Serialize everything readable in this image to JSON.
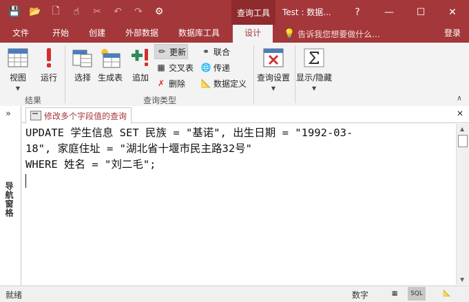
{
  "titlebar": {
    "context_title": "查询工具",
    "window_title": "Test : 数据...",
    "help": "?",
    "minimize": "—",
    "maximize": "☐",
    "close": "✕"
  },
  "qat": {
    "save_icon": "💾",
    "open_icon": "📂",
    "new_icon": "🗋",
    "touch_icon": "☝",
    "format_icon": "✂",
    "undo_icon": "↶",
    "redo_icon": "↷",
    "customize_icon": "⚙"
  },
  "menu": {
    "tabs": [
      "文件",
      "开始",
      "创建",
      "外部数据",
      "数据库工具",
      "设计"
    ],
    "active_index": 5,
    "tell_me": "告诉我您想要做什么...",
    "login": "登录"
  },
  "ribbon": {
    "view": "视图",
    "run": "运行",
    "select": "选择",
    "make_table": "生成表",
    "append": "追加",
    "update": "更新",
    "crosstab": "交叉表",
    "delete": "删除",
    "union": "联合",
    "pass_through": "传递",
    "data_definition": "数据定义",
    "query_setup": "查询设置",
    "show_hide": "显示/隐藏",
    "group_results": "结果",
    "group_query_type": "查询类型",
    "collapse": "∧"
  },
  "navpane": {
    "toggle": "»",
    "label": "导航窗格"
  },
  "document": {
    "tab_title": "修改多个字段值的查询",
    "close": "✕",
    "sql_lines": [
      "UPDATE 学生信息 SET 民族 = \"基诺\", 出生日期 = \"1992-03-",
      "18\", 家庭住址 = \"湖北省十堰市民主路32号\"",
      "WHERE 姓名 = \"刘二毛\";"
    ]
  },
  "statusbar": {
    "ready": "就绪",
    "mode": "数字",
    "sql_view": "SQL"
  },
  "colors": {
    "accent": "#a4373a",
    "accent_dark": "#8f2a2d",
    "ribbon_bg": "#f3f3f3"
  }
}
